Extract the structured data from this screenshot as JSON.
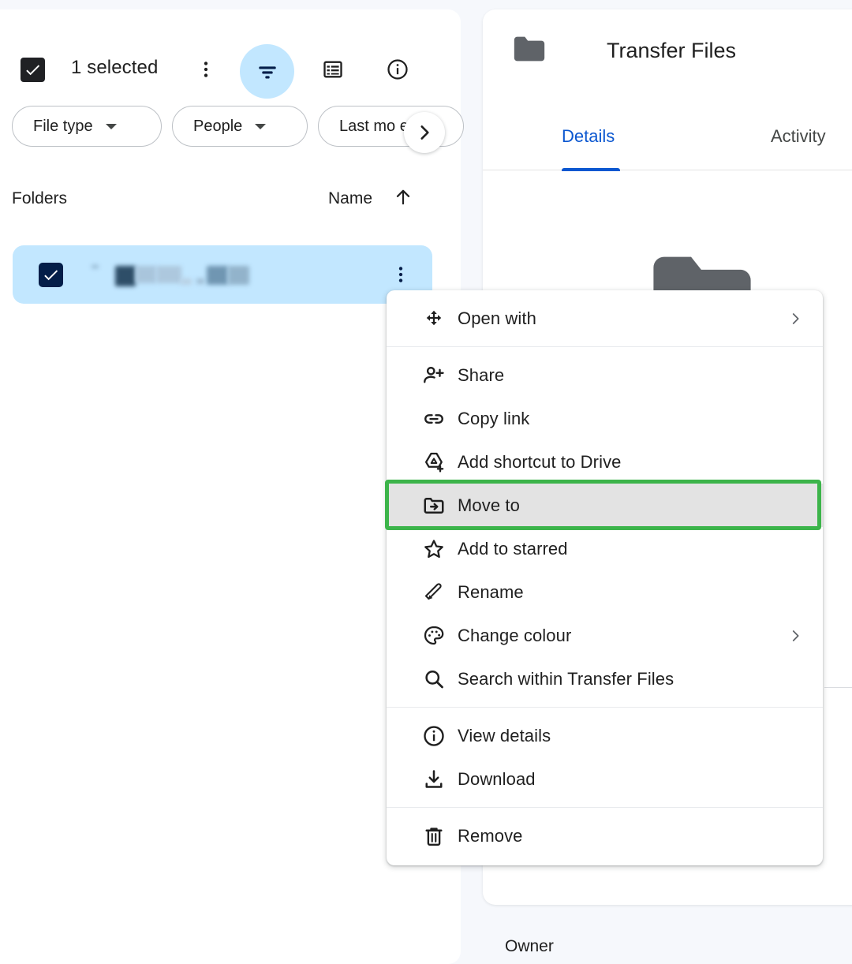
{
  "app": {
    "background_color": "#f6f8fc",
    "panel_color": "#ffffff"
  },
  "left_panel": {
    "toolbar": {
      "select_all_checkbox": "checked",
      "selected_label": "1 selected",
      "more_actions_icon": "more-vert-icon",
      "filter_icon": "filter-list-icon",
      "filter_active": true,
      "filter_active_color": "#c2e7ff",
      "list_view_icon": "list-view-icon",
      "info_icon": "info-outline-icon"
    },
    "filters": [
      {
        "label": "File type",
        "icon": "chevron-down-icon"
      },
      {
        "label": "People",
        "icon": "chevron-down-icon"
      },
      {
        "label": "Last mo           e",
        "icon": "chevron-down-icon"
      }
    ],
    "filters_next_icon": "chevron-right-icon",
    "section": {
      "title": "Folders",
      "sort_column": "Name",
      "sort_direction_icon": "arrow-up-icon"
    },
    "rows": [
      {
        "selected": true,
        "checkbox": "checked",
        "name_redacted": true,
        "row_color": "#c2e7ff",
        "checkbox_color": "#041e49",
        "more_icon": "more-vert-icon"
      }
    ]
  },
  "right_panel": {
    "folder_icon": "folder-icon",
    "title": "Transfer Files",
    "tabs": [
      {
        "label": "Details",
        "active": true
      },
      {
        "label": "Activity",
        "active": false
      }
    ],
    "active_tab_color": "#0b57d0",
    "preview_icon": "folder-icon-large",
    "owner_label": "Owner"
  },
  "context_menu": {
    "groups": [
      {
        "items": [
          {
            "label": "Open with",
            "icon": "open-with-move-icon",
            "submenu": true,
            "submenu_icon": "chevron-right-icon"
          }
        ]
      },
      {
        "items": [
          {
            "label": "Share",
            "icon": "person-add-icon",
            "submenu": false
          },
          {
            "label": "Copy link",
            "icon": "link-icon",
            "submenu": false
          },
          {
            "label": "Add shortcut to Drive",
            "icon": "add-shortcut-icon",
            "submenu": false
          },
          {
            "label": "Move to",
            "icon": "move-to-folder-icon",
            "submenu": false,
            "highlighted": true,
            "hover": true
          },
          {
            "label": "Add to starred",
            "icon": "star-outline-icon",
            "submenu": false
          },
          {
            "label": "Rename",
            "icon": "pencil-icon",
            "submenu": false
          },
          {
            "label": "Change colour",
            "icon": "palette-icon",
            "submenu": true,
            "submenu_icon": "chevron-right-icon"
          },
          {
            "label": "Search within Transfer Files",
            "icon": "search-icon",
            "submenu": false
          }
        ]
      },
      {
        "items": [
          {
            "label": "View details",
            "icon": "info-outline-icon",
            "submenu": false
          },
          {
            "label": "Download",
            "icon": "download-icon",
            "submenu": false
          }
        ]
      },
      {
        "items": [
          {
            "label": "Remove",
            "icon": "trash-icon",
            "submenu": false
          }
        ]
      }
    ],
    "highlight_color": "#3cb44a",
    "hover_background": "#e3e3e3"
  }
}
